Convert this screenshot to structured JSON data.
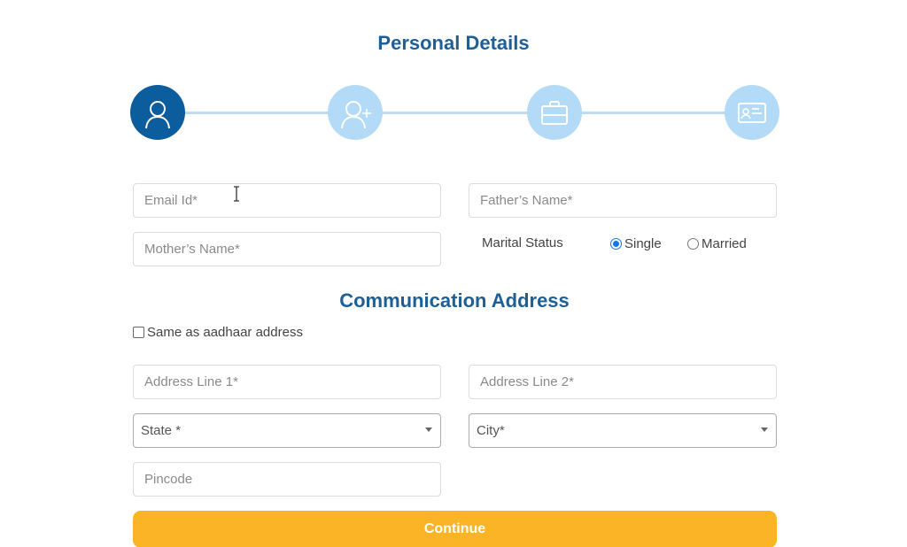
{
  "page_title": "Personal Details",
  "stepper": {
    "steps": [
      {
        "icon": "user-icon",
        "state": "active"
      },
      {
        "icon": "user-plus-icon",
        "state": "inactive"
      },
      {
        "icon": "briefcase-icon",
        "state": "inactive"
      },
      {
        "icon": "id-card-icon",
        "state": "inactive"
      }
    ],
    "colors": {
      "active": "#0b5d9e",
      "inactive": "#b3dbf7",
      "line": "#b7dcf4"
    }
  },
  "personal": {
    "email": {
      "placeholder": "Email Id*",
      "value": ""
    },
    "father_name": {
      "placeholder": "Father’s Name*",
      "value": ""
    },
    "mother_name": {
      "placeholder": "Mother’s Name*",
      "value": ""
    },
    "marital_status": {
      "label": "Marital Status",
      "options": [
        {
          "label": "Single",
          "checked": true
        },
        {
          "label": "Married",
          "checked": false
        }
      ]
    }
  },
  "address": {
    "section_title": "Communication Address",
    "same_as_aadhaar": {
      "label": "Same as aadhaar address",
      "checked": false
    },
    "line1": {
      "placeholder": "Address Line 1*",
      "value": ""
    },
    "line2": {
      "placeholder": "Address Line 2*",
      "value": ""
    },
    "state": {
      "selected": "State *"
    },
    "city": {
      "selected": "City*"
    },
    "pincode": {
      "placeholder": "Pincode",
      "value": ""
    }
  },
  "actions": {
    "continue_label": "Continue",
    "continue_color": "#fbb425"
  }
}
